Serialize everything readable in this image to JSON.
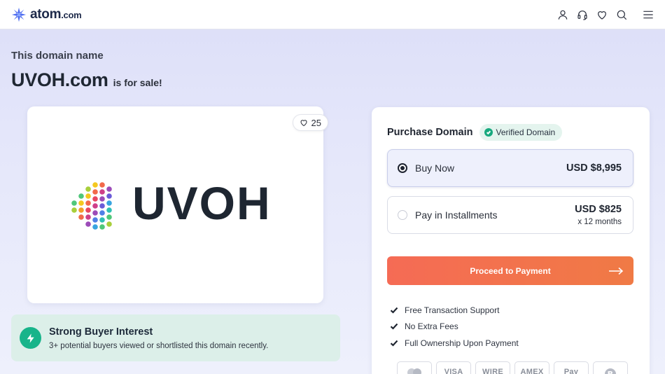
{
  "header": {
    "logo_text": "atom",
    "logo_suffix": ".com",
    "icons": [
      "user-icon",
      "headset-icon",
      "heart-icon",
      "search-icon",
      "menu-icon"
    ]
  },
  "hero": {
    "eyebrow": "This domain name",
    "domain": "UVOH.com",
    "sale_text": "is for sale!"
  },
  "logo_card": {
    "likes": "25",
    "brand_word": "UVOH"
  },
  "interest": {
    "title": "Strong Buyer Interest",
    "description": "3+ potential buyers viewed or shortlisted this domain recently."
  },
  "purchase": {
    "title": "Purchase Domain",
    "verified_label": "Verified Domain",
    "options": [
      {
        "label": "Buy Now",
        "price": "USD $8,995",
        "selected": true
      },
      {
        "label": "Pay in Installments",
        "price": "USD $825",
        "sub": "x 12 months",
        "selected": false
      }
    ],
    "cta": "Proceed to Payment",
    "features": [
      "Free Transaction Support",
      "No Extra Fees",
      "Full Ownership Upon Payment"
    ],
    "payment_methods": [
      "mastercard",
      "VISA",
      "WIRE",
      "AMEX",
      "Pay",
      "bitcoin"
    ]
  },
  "colors": {
    "accent": "#f56b55",
    "verified_green": "#17a97e",
    "interest_bg": "#dcefe9"
  }
}
